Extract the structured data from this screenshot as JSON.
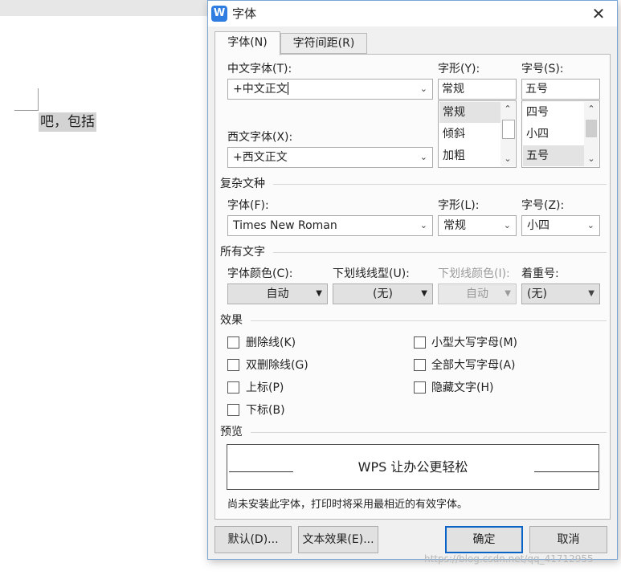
{
  "background": {
    "doc_text": "吧，包括"
  },
  "dialog": {
    "title": "字体",
    "app_icon_glyph": "W",
    "close_glyph": "✕",
    "tabs": [
      {
        "label": "字体(N)"
      },
      {
        "label": "字符间距(R)"
      }
    ]
  },
  "font": {
    "cn_font_label": "中文字体(T):",
    "cn_font_value": "+中文正文",
    "western_font_label": "西文字体(X):",
    "western_font_value": "+西文正文",
    "style_label": "字形(Y):",
    "style_value": "常规",
    "style_options": [
      "常规",
      "倾斜",
      "加粗"
    ],
    "size_label": "字号(S):",
    "size_value": "五号",
    "size_options": [
      "四号",
      "小四",
      "五号"
    ]
  },
  "complex": {
    "section": "复杂文种",
    "font_label": "字体(F):",
    "font_value": "Times New Roman",
    "style_label": "字形(L):",
    "style_value": "常规",
    "size_label": "字号(Z):",
    "size_value": "小四"
  },
  "all_text": {
    "section": "所有文字",
    "color_label": "字体颜色(C):",
    "color_value": "自动",
    "underline_label": "下划线线型(U):",
    "underline_value": "(无)",
    "underline_color_label": "下划线颜色(I):",
    "underline_color_value": "自动",
    "emphasis_label": "着重号:",
    "emphasis_value": "(无)"
  },
  "effects": {
    "section": "效果",
    "items": [
      {
        "label": "删除线(K)"
      },
      {
        "label": "双删除线(G)"
      },
      {
        "label": "上标(P)"
      },
      {
        "label": "下标(B)"
      },
      {
        "label": "小型大写字母(M)"
      },
      {
        "label": "全部大写字母(A)"
      },
      {
        "label": "隐藏文字(H)"
      }
    ]
  },
  "preview": {
    "section": "预览",
    "sample": "WPS 让办公更轻松",
    "note": "尚未安装此字体，打印时将采用最相近的有效字体。"
  },
  "buttons": {
    "default": "默认(D)...",
    "text_effect": "文本效果(E)...",
    "ok": "确定",
    "cancel": "取消"
  },
  "watermark": "https://blog.csdn.net/qq_41712955",
  "colors": {
    "accent": "#0a64c8",
    "selection": "#e3e3e3",
    "doc_highlight": "#d3d3d3"
  }
}
